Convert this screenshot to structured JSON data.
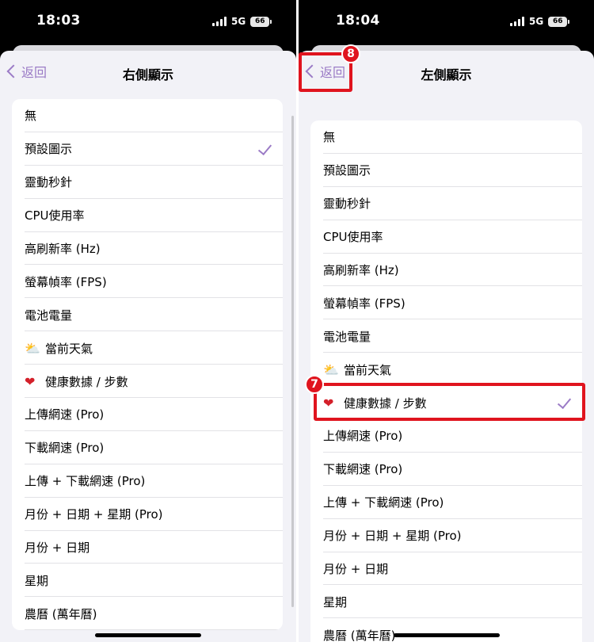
{
  "left": {
    "status": {
      "time": "18:03",
      "network": "5G",
      "battery": "66"
    },
    "nav": {
      "back_label": "返回",
      "title": "右側顯示"
    },
    "items": [
      {
        "label": "無",
        "icon": "",
        "selected": false
      },
      {
        "label": "預設圖示",
        "icon": "",
        "selected": true
      },
      {
        "label": "靈動秒針",
        "icon": "",
        "selected": false
      },
      {
        "label": "CPU使用率",
        "icon": "",
        "selected": false
      },
      {
        "label": "高刷新率 (Hz)",
        "icon": "",
        "selected": false
      },
      {
        "label": "螢幕幀率 (FPS)",
        "icon": "",
        "selected": false
      },
      {
        "label": "電池電量",
        "icon": "",
        "selected": false
      },
      {
        "label": "當前天氣",
        "icon": "sun-cloud-icon",
        "selected": false
      },
      {
        "label": "健康數據 / 步數",
        "icon": "heart-icon",
        "selected": false
      },
      {
        "label": "上傳網速 (Pro)",
        "icon": "",
        "selected": false
      },
      {
        "label": "下載網速 (Pro)",
        "icon": "",
        "selected": false
      },
      {
        "label": "上傳 + 下載網速 (Pro)",
        "icon": "",
        "selected": false
      },
      {
        "label": "月份 + 日期 + 星期 (Pro)",
        "icon": "",
        "selected": false
      },
      {
        "label": "月份 + 日期",
        "icon": "",
        "selected": false
      },
      {
        "label": "星期",
        "icon": "",
        "selected": false
      },
      {
        "label": "農曆 (萬年曆)",
        "icon": "",
        "selected": false
      }
    ]
  },
  "right": {
    "status": {
      "time": "18:04",
      "network": "5G",
      "battery": "66"
    },
    "nav": {
      "back_label": "返回",
      "title": "左側顯示"
    },
    "items": [
      {
        "label": "無",
        "icon": "",
        "selected": false
      },
      {
        "label": "預設圖示",
        "icon": "",
        "selected": false
      },
      {
        "label": "靈動秒針",
        "icon": "",
        "selected": false
      },
      {
        "label": "CPU使用率",
        "icon": "",
        "selected": false
      },
      {
        "label": "高刷新率 (Hz)",
        "icon": "",
        "selected": false
      },
      {
        "label": "螢幕幀率 (FPS)",
        "icon": "",
        "selected": false
      },
      {
        "label": "電池電量",
        "icon": "",
        "selected": false
      },
      {
        "label": "當前天氣",
        "icon": "sun-cloud-icon",
        "selected": false
      },
      {
        "label": "健康數據 / 步數",
        "icon": "heart-icon",
        "selected": true
      },
      {
        "label": "上傳網速 (Pro)",
        "icon": "",
        "selected": false
      },
      {
        "label": "下載網速 (Pro)",
        "icon": "",
        "selected": false
      },
      {
        "label": "上傳 + 下載網速 (Pro)",
        "icon": "",
        "selected": false
      },
      {
        "label": "月份 + 日期 + 星期 (Pro)",
        "icon": "",
        "selected": false
      },
      {
        "label": "月份 + 日期",
        "icon": "",
        "selected": false
      },
      {
        "label": "星期",
        "icon": "",
        "selected": false
      },
      {
        "label": "農曆 (萬年曆)",
        "icon": "",
        "selected": false
      }
    ]
  },
  "annotations": {
    "badge_back": "8",
    "badge_row": "7"
  },
  "colors": {
    "accent": "#9b7bc6",
    "highlight": "#e0141e"
  }
}
